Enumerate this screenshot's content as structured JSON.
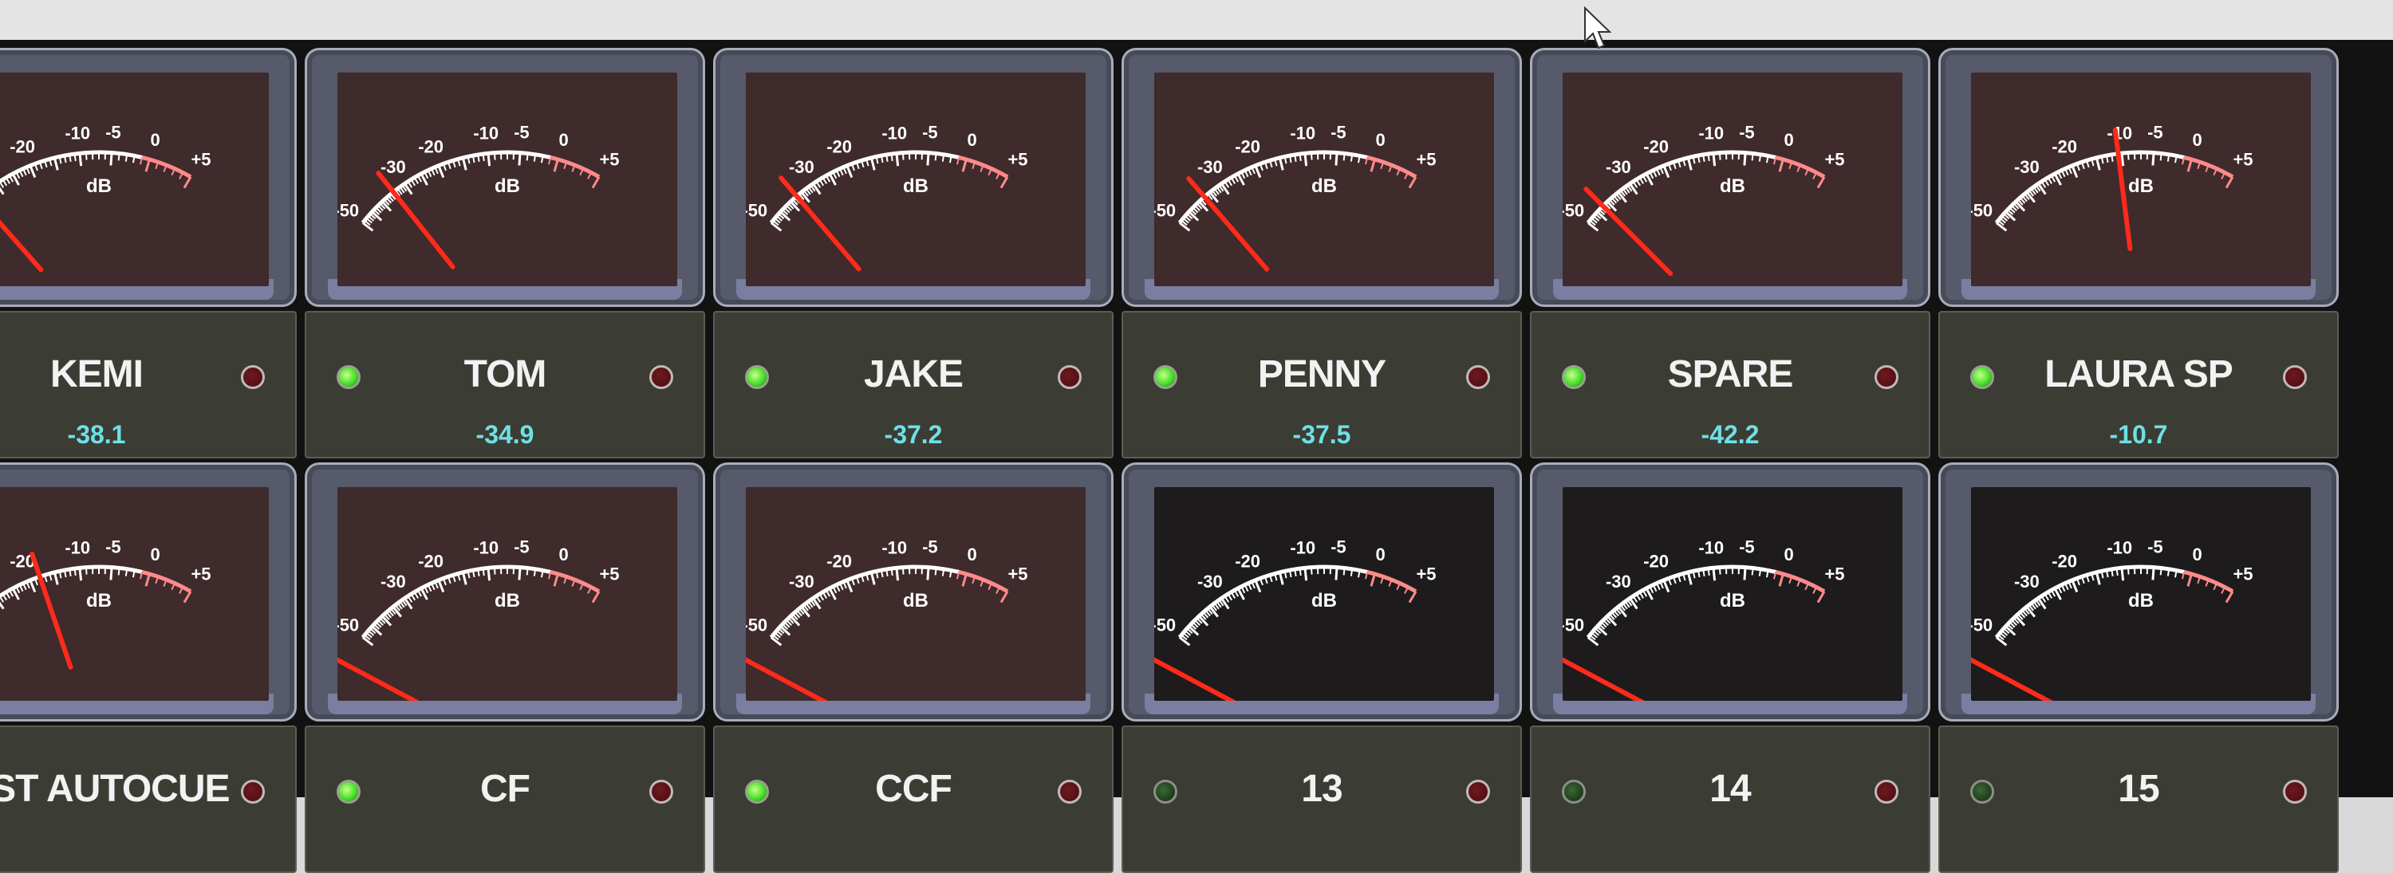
{
  "scale": {
    "label": "dB",
    "ticks": [
      "-50",
      "-30",
      "-20",
      "-10",
      "-5",
      "0",
      "+5"
    ]
  },
  "colors": {
    "needle": "#ff2a1a",
    "value_text": "#6ee0e6",
    "led_on": "#45e02a",
    "led_off": "#1f3e1c"
  },
  "rows": [
    {
      "channels": [
        {
          "name": "KEMI",
          "value": "-38.1",
          "level_db": -38.1,
          "led": "on",
          "face": "lit"
        },
        {
          "name": "TOM",
          "value": "-34.9",
          "level_db": -34.9,
          "led": "on",
          "face": "lit"
        },
        {
          "name": "JAKE",
          "value": "-37.2",
          "level_db": -37.2,
          "led": "on",
          "face": "lit"
        },
        {
          "name": "PENNY",
          "value": "-37.5",
          "level_db": -37.5,
          "led": "on",
          "face": "lit"
        },
        {
          "name": "SPARE",
          "value": "-42.2",
          "level_db": -42.2,
          "led": "on",
          "face": "lit"
        },
        {
          "name": "LAURA SP",
          "value": "-10.7",
          "level_db": -10.7,
          "led": "on",
          "face": "lit"
        }
      ]
    },
    {
      "channels": [
        {
          "name": "AST AUTOCUE",
          "value": "",
          "level_db": -18,
          "led": "none",
          "face": "lit"
        },
        {
          "name": "CF",
          "value": "",
          "level_db": -60,
          "led": "on",
          "face": "lit"
        },
        {
          "name": "CCF",
          "value": "",
          "level_db": -60,
          "led": "on",
          "face": "lit"
        },
        {
          "name": "13",
          "value": "",
          "level_db": -60,
          "led": "off",
          "face": "dark"
        },
        {
          "name": "14",
          "value": "",
          "level_db": -60,
          "led": "off",
          "face": "dark"
        },
        {
          "name": "15",
          "value": "",
          "level_db": -60,
          "led": "off",
          "face": "dark"
        }
      ]
    }
  ]
}
